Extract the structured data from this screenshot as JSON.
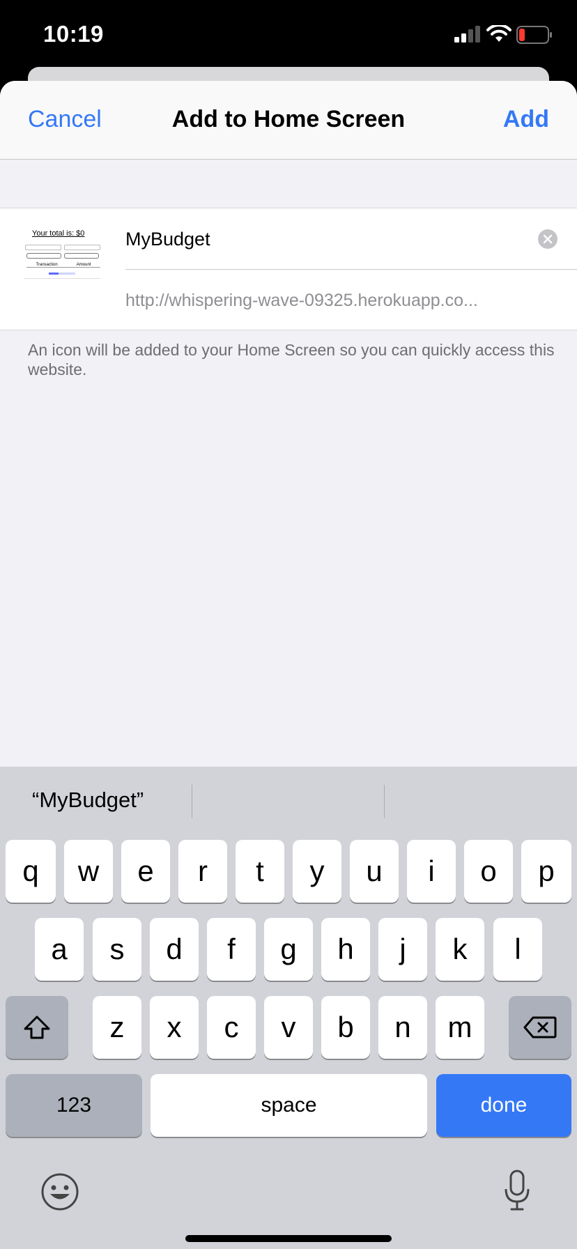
{
  "status_bar": {
    "time": "10:19"
  },
  "nav": {
    "cancel_label": "Cancel",
    "title": "Add to Home Screen",
    "add_label": "Add"
  },
  "form": {
    "name_value": "MyBudget",
    "url": "http://whispering-wave-09325.herokuapp.co...",
    "thumbnail": {
      "title": "Your total is: $0",
      "col_transaction": "Transaction",
      "col_amount": "Amount"
    }
  },
  "hint": "An icon will be added to your Home Screen so you can quickly access this website.",
  "keyboard": {
    "suggestions": [
      "“MyBudget”",
      "",
      ""
    ],
    "row1": [
      "q",
      "w",
      "e",
      "r",
      "t",
      "y",
      "u",
      "i",
      "o",
      "p"
    ],
    "row2": [
      "a",
      "s",
      "d",
      "f",
      "g",
      "h",
      "j",
      "k",
      "l"
    ],
    "row3": [
      "z",
      "x",
      "c",
      "v",
      "b",
      "n",
      "m"
    ],
    "numbers_label": "123",
    "space_label": "space",
    "done_label": "done"
  },
  "icons": {
    "signal": "cellular-signal-icon",
    "wifi": "wifi-icon",
    "battery": "battery-low-icon",
    "clear": "clear-text-icon",
    "shift": "shift-icon",
    "delete": "backspace-icon",
    "emoji": "emoji-icon",
    "mic": "microphone-icon"
  },
  "colors": {
    "accent": "#3478f6",
    "battery_low": "#ff3b30"
  }
}
